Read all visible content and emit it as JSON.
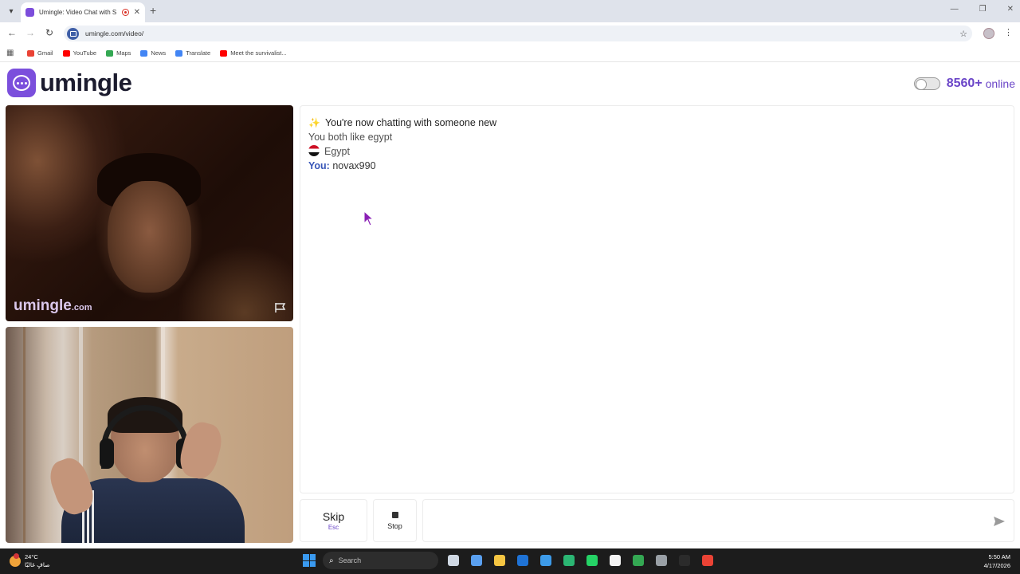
{
  "browser": {
    "tab_title": "Umingle: Video Chat with S",
    "url": "umingle.com/video/",
    "bookmarks": [
      {
        "label": "Gmail",
        "color": "#ea4335"
      },
      {
        "label": "YouTube",
        "color": "#ff0000"
      },
      {
        "label": "Maps",
        "color": "#34a853"
      },
      {
        "label": "News",
        "color": "#4285f4"
      },
      {
        "label": "Translate",
        "color": "#4285f4"
      },
      {
        "label": "Meet the survivalist...",
        "color": "#ff0000"
      }
    ]
  },
  "site": {
    "logo_text": "umingle",
    "online_count": "8560+",
    "online_label": "online",
    "accent_color": "#7b4fdc"
  },
  "video": {
    "watermark_main": "umingle",
    "watermark_suffix": ".com"
  },
  "chat": {
    "new_chat": "You're now chatting with someone new",
    "common_interest": "You both like egypt",
    "country": "Egypt",
    "you_label": "You:",
    "you_name": "novax990"
  },
  "controls": {
    "skip_label": "Skip",
    "skip_hint": "Esc",
    "stop_label": "Stop",
    "message_placeholder": ""
  },
  "taskbar": {
    "temperature": "24°C",
    "weather_text": "صافٍ غالبًا",
    "search_placeholder": "Search",
    "time": "5:50 AM",
    "date": "4/17/2026",
    "apps": [
      {
        "name": "task-view",
        "color": "#cfd8e3"
      },
      {
        "name": "copilot",
        "color": "#5aa0f0"
      },
      {
        "name": "file-explorer",
        "color": "#f5c542"
      },
      {
        "name": "outlook",
        "color": "#1f73d6"
      },
      {
        "name": "notepad",
        "color": "#3d9be9"
      },
      {
        "name": "edge",
        "color": "#2bb673"
      },
      {
        "name": "whatsapp",
        "color": "#25d366"
      },
      {
        "name": "microsoft-store",
        "color": "#f3f3f3"
      },
      {
        "name": "chrome",
        "color": "#34a853"
      },
      {
        "name": "settings",
        "color": "#9aa0a6"
      },
      {
        "name": "app-circle",
        "color": "#2b2b2b"
      },
      {
        "name": "chrome-active",
        "color": "#ea4335"
      }
    ]
  }
}
